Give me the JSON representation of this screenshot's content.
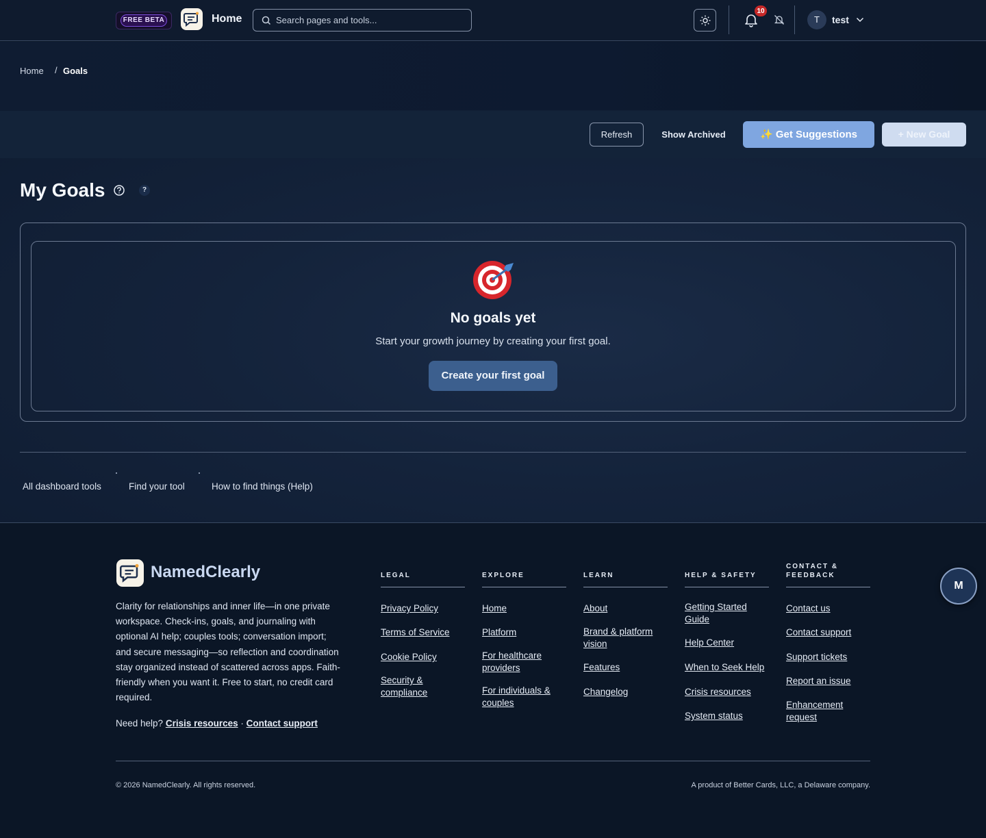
{
  "header": {
    "beta_label": "FREE BETA",
    "title": "Home",
    "search_placeholder": "Search pages and tools...",
    "notifications_count": "10",
    "user_initial": "T",
    "user_name": "test"
  },
  "breadcrumb": {
    "home": "Home",
    "separator": "/",
    "current": "Goals"
  },
  "toolbar": {
    "refresh": "Refresh",
    "show_archived": "Show Archived",
    "get_suggestions": "✨ Get Suggestions",
    "new_goal": "+ New Goal"
  },
  "main": {
    "title": "My Goals",
    "help_label": "?",
    "empty_title": "No goals yet",
    "empty_subtitle": "Start your growth journey by creating your first goal.",
    "create_button": "Create your first goal"
  },
  "tool_links": [
    "All dashboard tools",
    "Find your tool",
    "How to find things (Help)"
  ],
  "footer": {
    "brand": "NamedClearly",
    "description": "Clarity for relationships and inner life—in one private workspace. Check-ins, goals, and journaling with optional AI help; couples tools; conversation import; and secure messaging—so reflection and coordination stay organized instead of scattered across apps. Faith-friendly when you want it. Free to start, no credit card required.",
    "help_prefix": "Need help?",
    "help_crisis": "Crisis resources",
    "help_dot": "·",
    "help_contact": "Contact support",
    "columns": [
      {
        "heading": "LEGAL",
        "links": [
          "Privacy Policy",
          "Terms of Service",
          "Cookie Policy",
          "Security & compliance"
        ]
      },
      {
        "heading": "EXPLORE",
        "links": [
          "Home",
          "Platform",
          "For healthcare providers",
          "For individuals & couples"
        ]
      },
      {
        "heading": "LEARN",
        "links": [
          "About",
          "Brand & platform vision",
          "Features",
          "Changelog"
        ]
      },
      {
        "heading": "HELP & SAFETY",
        "links": [
          "Getting Started Guide",
          "Help Center",
          "When to Seek Help",
          "Crisis resources",
          "System status"
        ]
      },
      {
        "heading": "CONTACT & FEEDBACK",
        "links": [
          "Contact us",
          "Contact support",
          "Support tickets",
          "Report an issue",
          "Enhancement request"
        ]
      }
    ],
    "copyright": "© 2026 NamedClearly. All rights reserved.",
    "product": "A product of Better Cards, LLC, a Delaware company."
  },
  "fab": {
    "label": "M"
  },
  "colors": {
    "accent": "#7fa6e0",
    "primary_button": "#3c5f8e",
    "badge": "#c62828",
    "background": "#0b1628"
  }
}
